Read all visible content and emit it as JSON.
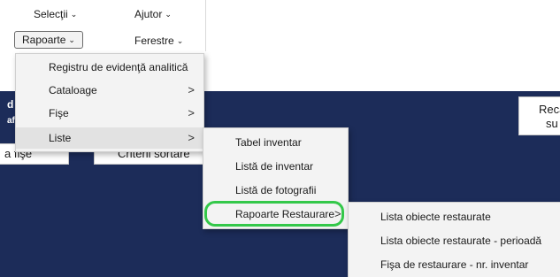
{
  "menubar": {
    "selectii": "Selecţii",
    "ajutor": "Ajutor",
    "rapoarte": "Rapoarte",
    "ferestre": "Ferestre",
    "chevron_icon": "chevron-down-icon"
  },
  "background": {
    "left_text_1": "d",
    "left_text_2": "af",
    "right_text_1": "Reca",
    "right_text_2": "su",
    "btn_fise": "a fişe",
    "btn_criterii": "Criterii sortare"
  },
  "rapoarte_menu": {
    "items": [
      {
        "label": "Registru de evidenţă analitică",
        "has_submenu": false
      },
      {
        "label": "Cataloage",
        "has_submenu": true
      },
      {
        "label": "Fişe",
        "has_submenu": true
      },
      {
        "label": "Liste",
        "has_submenu": true
      }
    ],
    "arrow_glyph": ">"
  },
  "liste_menu": {
    "items": [
      {
        "label": "Tabel inventar"
      },
      {
        "label": "Listă de inventar"
      },
      {
        "label": "Listă de fotografii"
      },
      {
        "label": "Rapoarte Restaurare"
      }
    ],
    "arrow_glyph": ">"
  },
  "restaurare_menu": {
    "items": [
      {
        "label": "Lista obiecte restaurate"
      },
      {
        "label": "Lista obiecte restaurate - perioadă"
      },
      {
        "label": "Fişa de restaurare - nr. inventar"
      }
    ]
  },
  "colors": {
    "navy_background": "#1c2c59",
    "menu_background": "#f3f3f3",
    "highlight_ring": "#34c84a"
  }
}
